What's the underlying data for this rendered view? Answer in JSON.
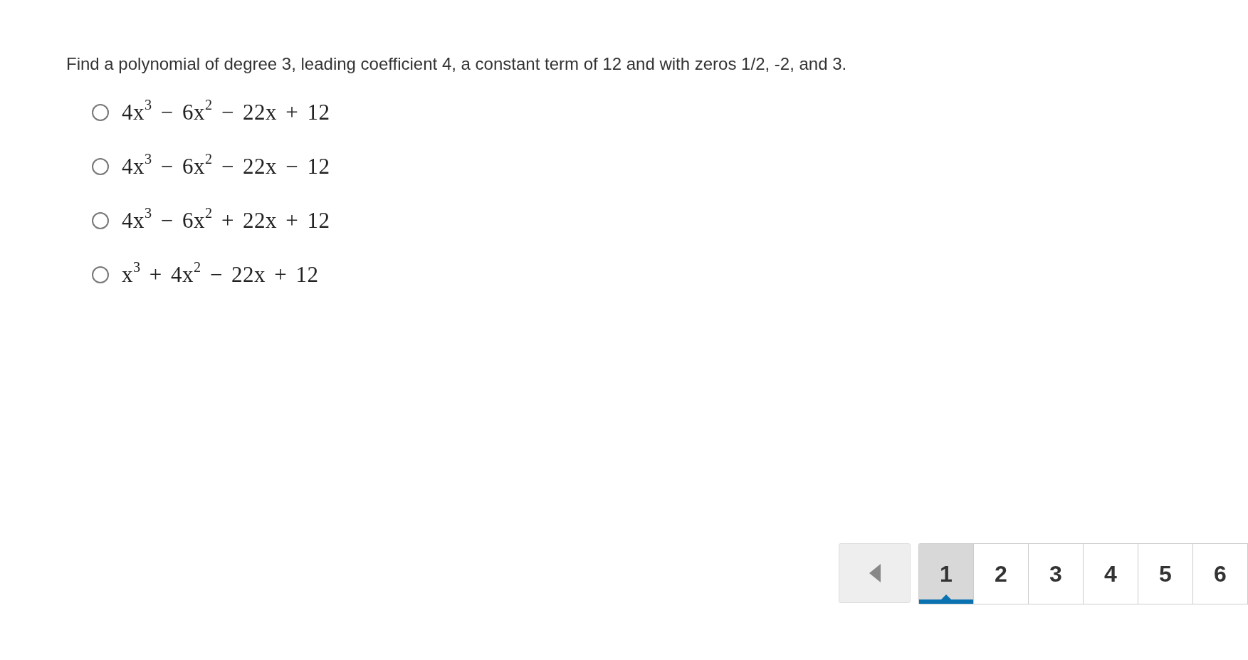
{
  "question": {
    "prompt": "Find a polynomial of degree 3, leading coefficient 4, a constant term of 12 and with zeros 1/2, -2, and 3.",
    "options": [
      {
        "text": "4x$^{3}$ − 6x$^{2}$ − 22x + 12",
        "selected": false
      },
      {
        "text": "4x$^{3}$ − 6x$^{2}$ − 22x − 12",
        "selected": false
      },
      {
        "text": "4x$^{3}$ − 6x$^{2}$ + 22x + 12",
        "selected": false
      },
      {
        "text": "x$^{3}$ + 4x$^{2}$ − 22x + 12",
        "selected": false
      }
    ]
  },
  "pagination": {
    "pages": [
      {
        "label": "1",
        "selected": true
      },
      {
        "label": "2",
        "selected": false
      },
      {
        "label": "3",
        "selected": false
      },
      {
        "label": "4",
        "selected": false
      },
      {
        "label": "5",
        "selected": false
      },
      {
        "label": "6",
        "selected": false
      }
    ]
  }
}
